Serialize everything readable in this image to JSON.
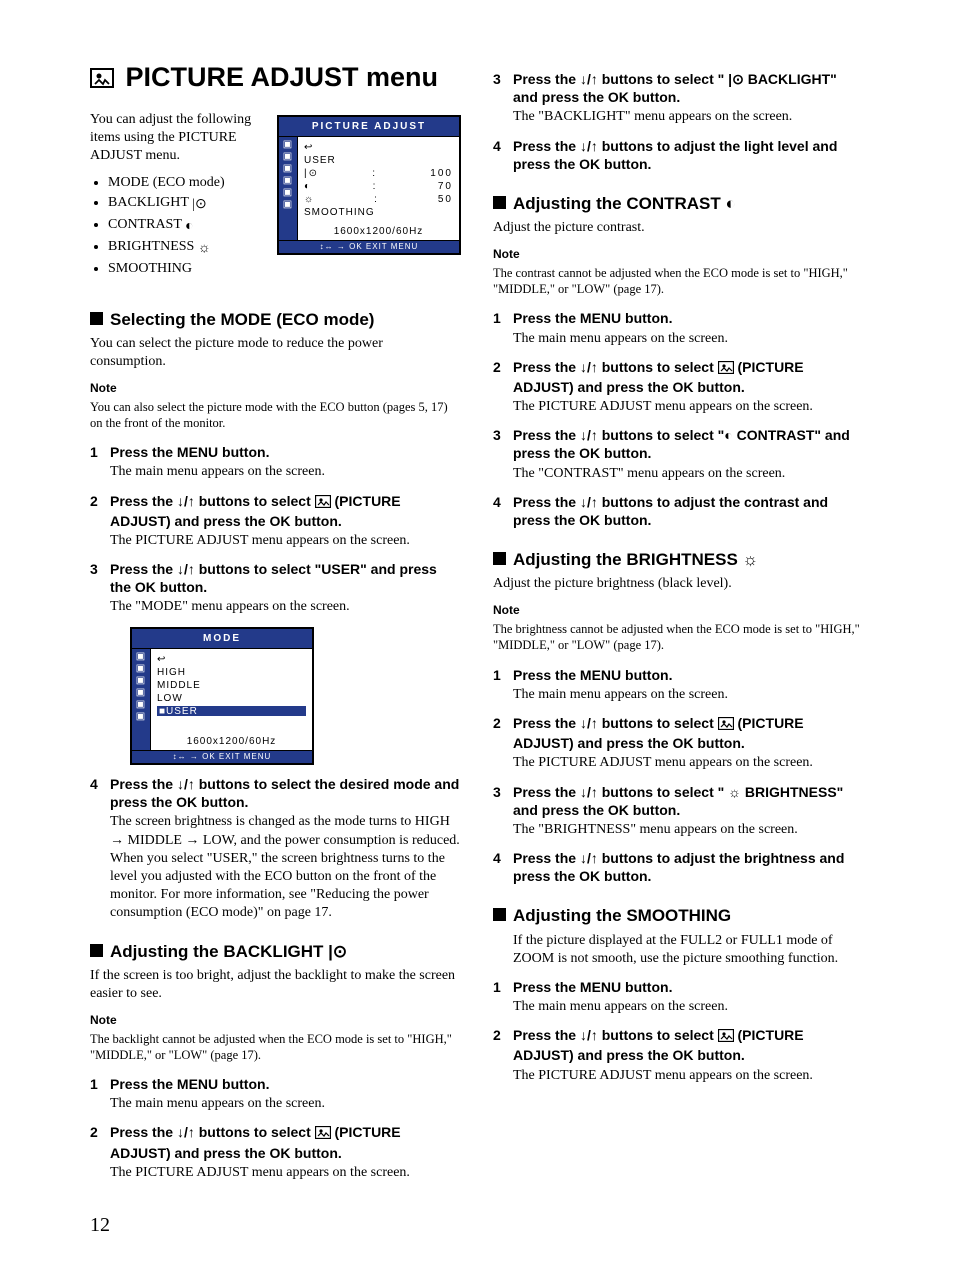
{
  "title": "PICTURE ADJUST menu",
  "intro": "You can adjust the following items using the PICTURE ADJUST menu.",
  "bullets": {
    "mode": "MODE (ECO mode)",
    "backlight": "BACKLIGHT",
    "contrast": "CONTRAST",
    "brightness": "BRIGHTNESS",
    "smoothing": "SMOOTHING"
  },
  "osd1": {
    "title": "PICTURE ADJUST",
    "user": "USER",
    "v1": "100",
    "v2": "70",
    "v3": "50",
    "smoothing": "SMOOTHING",
    "res": "1600x1200/60Hz",
    "foot": "↕↔  →  OK    EXIT MENU"
  },
  "osd2": {
    "title": "MODE",
    "r1": "HIGH",
    "r2": "MIDDLE",
    "r3": "LOW",
    "r4": "■USER",
    "res": "1600x1200/60Hz",
    "foot": "↕↔  →  OK    EXIT MENU"
  },
  "sec_mode": {
    "h": "Selecting the MODE (ECO mode)",
    "p": "You can select the picture mode to reduce the power consumption.",
    "note_h": "Note",
    "note": "You can also select the picture mode with the ECO button (pages 5, 17) on the front of the monitor.",
    "s1n": "1",
    "s1c": "Press the MENU button.",
    "s1r": "The main menu appears on the screen.",
    "s2n": "2",
    "s2c_a": "Press the ",
    "s2c_b": " buttons to select ",
    "s2c_c": " (PICTURE ADJUST) and press the OK button.",
    "s2r": "The PICTURE ADJUST menu appears on the screen.",
    "s3n": "3",
    "s3c_a": "Press the ",
    "s3c_b": " buttons to select \"USER\" and press the OK button.",
    "s3r": "The \"MODE\" menu appears on the screen.",
    "s4n": "4",
    "s4c_a": "Press the ",
    "s4c_b": " buttons to select the desired mode and press the OK button.",
    "s4r": "The screen brightness is changed as the mode turns to HIGH → MIDDLE → LOW, and the power consumption is reduced. When you select \"USER,\" the screen brightness turns to the level you adjusted with the ECO button on the front of the monitor. For more information, see \"Reducing the power consumption (ECO mode)\" on page 17."
  },
  "sec_backlight": {
    "h": "Adjusting the BACKLIGHT ",
    "p": "If the screen is too bright, adjust the backlight to make the screen easier to see.",
    "note_h": "Note",
    "note": "The backlight cannot be adjusted when the ECO mode is set to \"HIGH,\" \"MIDDLE,\" or \"LOW\" (page 17).",
    "s1n": "1",
    "s1c": "Press the MENU button.",
    "s1r": "The main menu appears on the screen.",
    "s2n": "2",
    "s2c_a": "Press the ",
    "s2c_b": " buttons to select ",
    "s2c_c": " (PICTURE ADJUST) and press the OK button.",
    "s2r": "The PICTURE ADJUST menu appears on the screen.",
    "s3n": "3",
    "s3c_a": "Press the ",
    "s3c_b": " buttons to select \" ",
    "s3c_c": " BACKLIGHT\" and press the OK button.",
    "s3r": "The \"BACKLIGHT\" menu appears on the screen.",
    "s4n": "4",
    "s4c_a": "Press the ",
    "s4c_b": " buttons to adjust the light level and press the OK button."
  },
  "sec_contrast": {
    "h": "Adjusting the CONTRAST ",
    "p": "Adjust the picture contrast.",
    "note_h": "Note",
    "note": "The contrast cannot be adjusted when the ECO mode is set to \"HIGH,\" \"MIDDLE,\" or \"LOW\" (page 17).",
    "s1n": "1",
    "s1c": "Press the MENU button.",
    "s1r": "The main menu appears on the screen.",
    "s2n": "2",
    "s2c_a": "Press the ",
    "s2c_b": " buttons to select ",
    "s2c_c": " (PICTURE ADJUST) and press the OK button.",
    "s2r": "The PICTURE ADJUST menu appears on the screen.",
    "s3n": "3",
    "s3c_a": "Press the ",
    "s3c_b": " buttons to select \"",
    "s3c_c": " CONTRAST\" and press the OK button.",
    "s3r": "The \"CONTRAST\" menu appears on the screen.",
    "s4n": "4",
    "s4c_a": "Press the ",
    "s4c_b": " buttons to adjust the contrast and press the OK button."
  },
  "sec_brightness": {
    "h": "Adjusting the BRIGHTNESS ",
    "p": "Adjust the picture brightness (black level).",
    "note_h": "Note",
    "note": "The brightness cannot be adjusted when the ECO mode is set to \"HIGH,\" \"MIDDLE,\" or \"LOW\" (page 17).",
    "s1n": "1",
    "s1c": "Press the MENU button.",
    "s1r": "The main menu appears on the screen.",
    "s2n": "2",
    "s2c_a": "Press the ",
    "s2c_b": " buttons to select ",
    "s2c_c": " (PICTURE ADJUST) and press the OK button.",
    "s2r": "The PICTURE ADJUST menu appears on the screen.",
    "s3n": "3",
    "s3c_a": "Press the ",
    "s3c_b": " buttons to select \" ",
    "s3c_c": " BRIGHTNESS\" and press the OK button.",
    "s3r": "The \"BRIGHTNESS\" menu appears on the screen.",
    "s4n": "4",
    "s4c_a": "Press the ",
    "s4c_b": " buttons to adjust the brightness and press the OK button."
  },
  "sec_smoothing": {
    "h": "Adjusting the SMOOTHING",
    "p": "If the picture displayed at the FULL2 or FULL1 mode of ZOOM is not smooth, use the picture smoothing function.",
    "s1n": "1",
    "s1c": "Press the MENU button.",
    "s1r": "The main menu appears on the screen.",
    "s2n": "2",
    "s2c_a": "Press the ",
    "s2c_b": " buttons to select ",
    "s2c_c": " (PICTURE ADJUST) and press the OK button.",
    "s2r": "The PICTURE ADJUST menu appears on the screen."
  },
  "page_num": "12"
}
